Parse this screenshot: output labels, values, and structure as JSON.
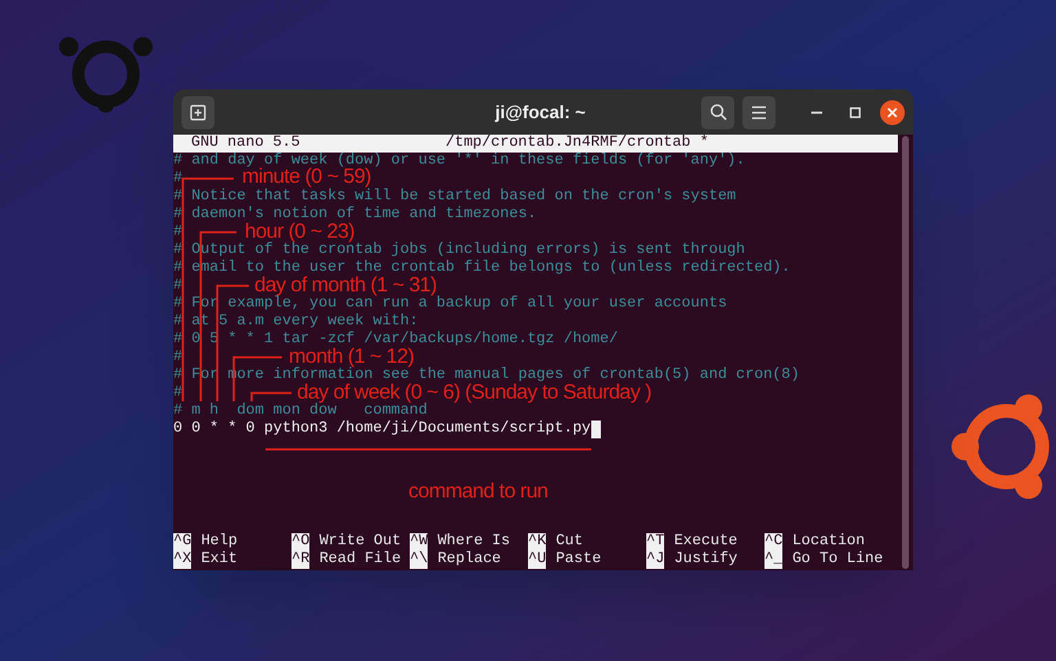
{
  "window": {
    "title": "ji@focal: ~"
  },
  "editor": {
    "header": {
      "app": "GNU nano 5.5",
      "file": "/tmp/crontab.Jn4RMF/crontab *"
    },
    "lines": [
      {
        "kind": "comment",
        "text": "# and day of week (dow) or use '*' in these fields (for 'any')."
      },
      {
        "kind": "comment",
        "text": "#"
      },
      {
        "kind": "comment",
        "text": "# Notice that tasks will be started based on the cron's system"
      },
      {
        "kind": "comment",
        "text": "# daemon's notion of time and timezones."
      },
      {
        "kind": "comment",
        "text": "#"
      },
      {
        "kind": "comment",
        "text": "# Output of the crontab jobs (including errors) is sent through"
      },
      {
        "kind": "comment",
        "text": "# email to the user the crontab file belongs to (unless redirected)."
      },
      {
        "kind": "comment",
        "text": "#"
      },
      {
        "kind": "comment",
        "text": "# For example, you can run a backup of all your user accounts"
      },
      {
        "kind": "comment",
        "text": "# at 5 a.m every week with:"
      },
      {
        "kind": "comment",
        "text": "# 0 5 * * 1 tar -zcf /var/backups/home.tgz /home/"
      },
      {
        "kind": "comment",
        "text": "#"
      },
      {
        "kind": "comment",
        "text": "# For more information see the manual pages of crontab(5) and cron(8)"
      },
      {
        "kind": "comment",
        "text": "#"
      },
      {
        "kind": "comment",
        "text": "# m h  dom mon dow   command"
      },
      {
        "kind": "command",
        "text": "0 0 * * 0 python3 /home/ji/Documents/script.py",
        "cursor": true
      }
    ],
    "shortcuts": [
      {
        "key": "^G",
        "label": "Help"
      },
      {
        "key": "^O",
        "label": "Write Out"
      },
      {
        "key": "^W",
        "label": "Where Is"
      },
      {
        "key": "^K",
        "label": "Cut"
      },
      {
        "key": "^T",
        "label": "Execute"
      },
      {
        "key": "^C",
        "label": "Location"
      },
      {
        "key": "^X",
        "label": "Exit"
      },
      {
        "key": "^R",
        "label": "Read File"
      },
      {
        "key": "^\\",
        "label": "Replace"
      },
      {
        "key": "^U",
        "label": "Paste"
      },
      {
        "key": "^J",
        "label": "Justify"
      },
      {
        "key": "^_",
        "label": "Go To Line"
      }
    ]
  },
  "annotations": [
    {
      "text": "minute (0 ~ 59)"
    },
    {
      "text": "hour (0 ~ 23)"
    },
    {
      "text": "day of month (1 ~ 31)"
    },
    {
      "text": "month (1 ~ 12)"
    },
    {
      "text": "day of week (0 ~ 6) (Sunday to Saturday )"
    },
    {
      "text": "command to run"
    }
  ]
}
